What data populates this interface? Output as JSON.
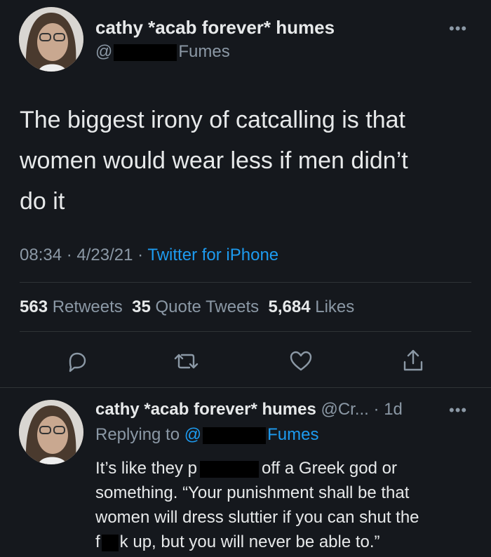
{
  "tweet": {
    "display_name": "cathy *acab forever* humes",
    "handle_prefix": "@",
    "handle_suffix": "Fumes",
    "text_line1": "The biggest irony of catcalling is that",
    "text_line2": "women would wear less if men didn’t",
    "text_line3": "do it",
    "time": "08:34",
    "date": "4/23/21",
    "client": "Twitter for iPhone",
    "sep": "·",
    "retweets_count": "563",
    "retweets_label": "Retweets",
    "quotes_count": "35",
    "quotes_label": "Quote Tweets",
    "likes_count": "5,684",
    "likes_label": "Likes",
    "more": "•••"
  },
  "reply": {
    "display_name": "cathy *acab forever* humes",
    "handle_short": "@Cr...",
    "age": "· 1d",
    "replying_label": "Replying to",
    "replying_prefix": "@",
    "replying_suffix": "Fumes",
    "line1_a": "It’s like they p",
    "line1_b": "off a Greek god or",
    "line2": "something. “Your punishment shall be that",
    "line3": "women will dress sluttier if you can shut the",
    "line4_a": "f",
    "line4_b": "k up, but you will never be able to.”",
    "more": "•••"
  },
  "icons": [
    "reply-icon",
    "retweet-icon",
    "like-icon",
    "share-icon"
  ],
  "colors": {
    "background": "#15181d",
    "link": "#1d9bf0",
    "muted": "#8b98a5",
    "text": "#e7e9ea"
  }
}
